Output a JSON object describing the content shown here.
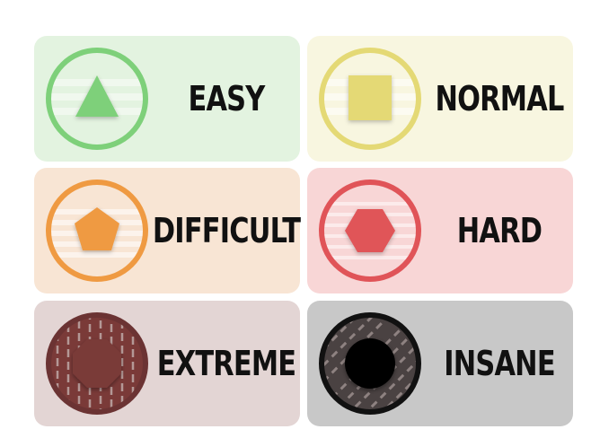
{
  "difficulties": [
    {
      "id": "easy",
      "label": "EASY",
      "shape": "triangle-icon",
      "bg": "#e3f3e0",
      "accent": "#7ed07a",
      "fill": "#7ed07a"
    },
    {
      "id": "normal",
      "label": "NORMAL",
      "shape": "square-icon",
      "bg": "#f8f6e0",
      "accent": "#e4d975",
      "fill": "#e4d975"
    },
    {
      "id": "difficult",
      "label": "DIFFICULT",
      "shape": "pentagon-icon",
      "bg": "#f8e5d4",
      "accent": "#ef9a42",
      "fill": "#ef9a42"
    },
    {
      "id": "hard",
      "label": "HARD",
      "shape": "hexagon-icon",
      "bg": "#f8d6d6",
      "accent": "#e05458",
      "fill": "#e05458"
    },
    {
      "id": "extreme",
      "label": "EXTREME",
      "shape": "octagon-icon",
      "bg": "#e3d5d4",
      "accent": "#6b3333",
      "fill": "#7a3a38"
    },
    {
      "id": "insane",
      "label": "INSANE",
      "shape": "circle-icon",
      "bg": "#c8c8c8",
      "accent": "#111111",
      "fill": "#000000"
    }
  ]
}
